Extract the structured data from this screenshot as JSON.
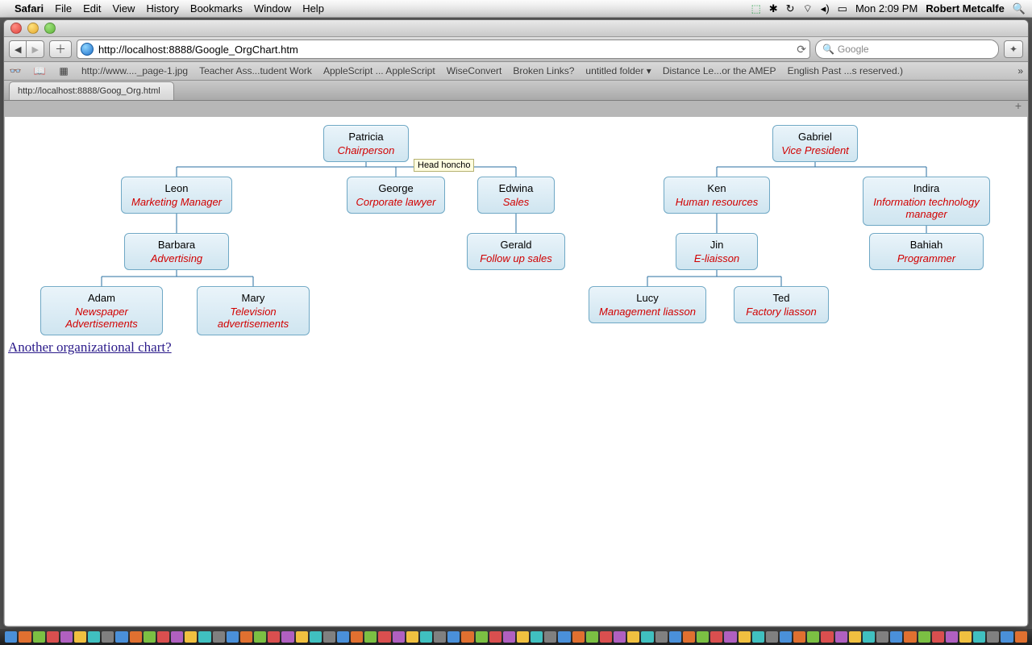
{
  "menubar": {
    "app": "Safari",
    "items": [
      "File",
      "Edit",
      "View",
      "History",
      "Bookmarks",
      "Window",
      "Help"
    ],
    "time": "Mon 2:09 PM",
    "user": "Robert Metcalfe"
  },
  "toolbar": {
    "back": "◀",
    "fwd": "▶",
    "add": "＋",
    "url": "http://localhost:8888/Google_OrgChart.htm",
    "reload": "⟳",
    "search_placeholder": "Google",
    "bug": "✦"
  },
  "bookmarks": {
    "items": [
      "http://www...._page-1.jpg",
      "Teacher Ass...tudent Work",
      "AppleScript ... AppleScript",
      "WiseConvert",
      "Broken Links?",
      "untitled folder ▾",
      "Distance Le...or the AMEP",
      "English Past ...s reserved.)"
    ],
    "overflow": "»"
  },
  "tab": {
    "title": "http://localhost:8888/Goog_Org.html"
  },
  "tooltip": "Head honcho",
  "nodes": {
    "patricia": {
      "name": "Patricia",
      "role": "Chairperson"
    },
    "gabriel": {
      "name": "Gabriel",
      "role": "Vice President"
    },
    "leon": {
      "name": "Leon",
      "role": "Marketing Manager"
    },
    "george": {
      "name": "George",
      "role": "Corporate lawyer"
    },
    "edwina": {
      "name": "Edwina",
      "role": "Sales"
    },
    "ken": {
      "name": "Ken",
      "role": "Human resources"
    },
    "indira": {
      "name": "Indira",
      "role": "Information technology manager"
    },
    "barbara": {
      "name": "Barbara",
      "role": "Advertising"
    },
    "gerald": {
      "name": "Gerald",
      "role": "Follow up sales"
    },
    "jin": {
      "name": "Jin",
      "role": "E-liaisson"
    },
    "bahiah": {
      "name": "Bahiah",
      "role": "Programmer"
    },
    "adam": {
      "name": "Adam",
      "role": "Newspaper Advertisements"
    },
    "mary": {
      "name": "Mary",
      "role": "Television advertisements"
    },
    "lucy": {
      "name": "Lucy",
      "role": "Management liasson"
    },
    "ted": {
      "name": "Ted",
      "role": "Factory liasson"
    }
  },
  "link": "Another organizational chart?",
  "chart_data": {
    "type": "org-chart",
    "roots": [
      "Patricia",
      "Gabriel"
    ],
    "edges": [
      [
        "Patricia",
        "Leon"
      ],
      [
        "Patricia",
        "George"
      ],
      [
        "Patricia",
        "Edwina"
      ],
      [
        "Gabriel",
        "Ken"
      ],
      [
        "Gabriel",
        "Indira"
      ],
      [
        "Leon",
        "Barbara"
      ],
      [
        "Edwina",
        "Gerald"
      ],
      [
        "Ken",
        "Jin"
      ],
      [
        "Indira",
        "Bahiah"
      ],
      [
        "Barbara",
        "Adam"
      ],
      [
        "Barbara",
        "Mary"
      ],
      [
        "Jin",
        "Lucy"
      ],
      [
        "Jin",
        "Ted"
      ]
    ],
    "people": [
      {
        "name": "Patricia",
        "role": "Chairperson",
        "tooltip": "Head honcho"
      },
      {
        "name": "Gabriel",
        "role": "Vice President"
      },
      {
        "name": "Leon",
        "role": "Marketing Manager"
      },
      {
        "name": "George",
        "role": "Corporate lawyer"
      },
      {
        "name": "Edwina",
        "role": "Sales"
      },
      {
        "name": "Ken",
        "role": "Human resources"
      },
      {
        "name": "Indira",
        "role": "Information technology manager"
      },
      {
        "name": "Barbara",
        "role": "Advertising"
      },
      {
        "name": "Gerald",
        "role": "Follow up sales"
      },
      {
        "name": "Jin",
        "role": "E-liaisson"
      },
      {
        "name": "Bahiah",
        "role": "Programmer"
      },
      {
        "name": "Adam",
        "role": "Newspaper Advertisements"
      },
      {
        "name": "Mary",
        "role": "Television advertisements"
      },
      {
        "name": "Lucy",
        "role": "Management liasson"
      },
      {
        "name": "Ted",
        "role": "Factory liasson"
      }
    ]
  }
}
